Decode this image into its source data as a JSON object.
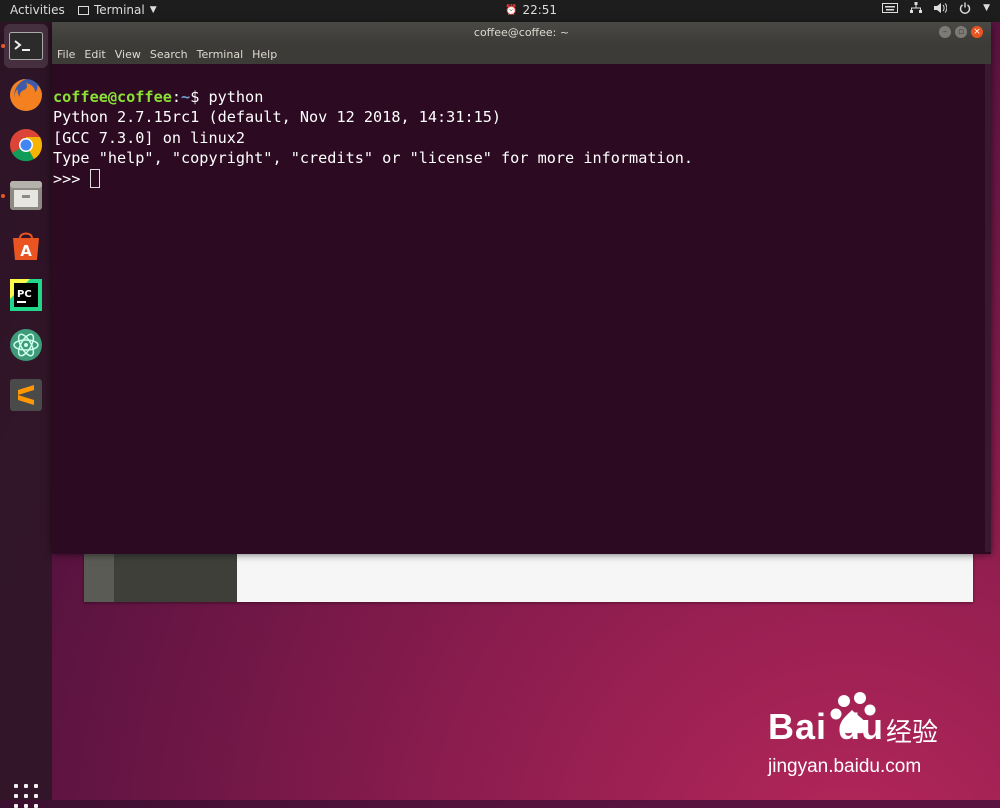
{
  "topbar": {
    "activities": "Activities",
    "app_name": "Terminal",
    "clock": "22:51",
    "clock_prefix": "⏰"
  },
  "dock": {
    "items": [
      {
        "name": "terminal",
        "active": true
      },
      {
        "name": "firefox"
      },
      {
        "name": "chrome"
      },
      {
        "name": "files"
      },
      {
        "name": "software"
      },
      {
        "name": "pycharm"
      },
      {
        "name": "atom"
      },
      {
        "name": "sublime"
      }
    ]
  },
  "window": {
    "title": "coffee@coffee: ~",
    "menu": [
      "File",
      "Edit",
      "View",
      "Search",
      "Terminal",
      "Help"
    ]
  },
  "terminal": {
    "prompt_user": "coffee@coffee",
    "prompt_sep": ":",
    "prompt_path": "~",
    "prompt_symbol": "$",
    "command": " python",
    "lines": [
      "Python 2.7.15rc1 (default, Nov 12 2018, 14:31:15)",
      "[GCC 7.3.0] on linux2",
      "Type \"help\", \"copyright\", \"credits\" or \"license\" for more information."
    ],
    "repl_prompt": ">>> "
  },
  "watermark": {
    "brand": "Bai du",
    "brand_cn": "经验",
    "url": "jingyan.baidu.com"
  },
  "colors": {
    "accent": "#e95420",
    "terminal_bg": "#2c0a22",
    "prompt_user": "#8ae234",
    "prompt_path": "#729fcf"
  }
}
